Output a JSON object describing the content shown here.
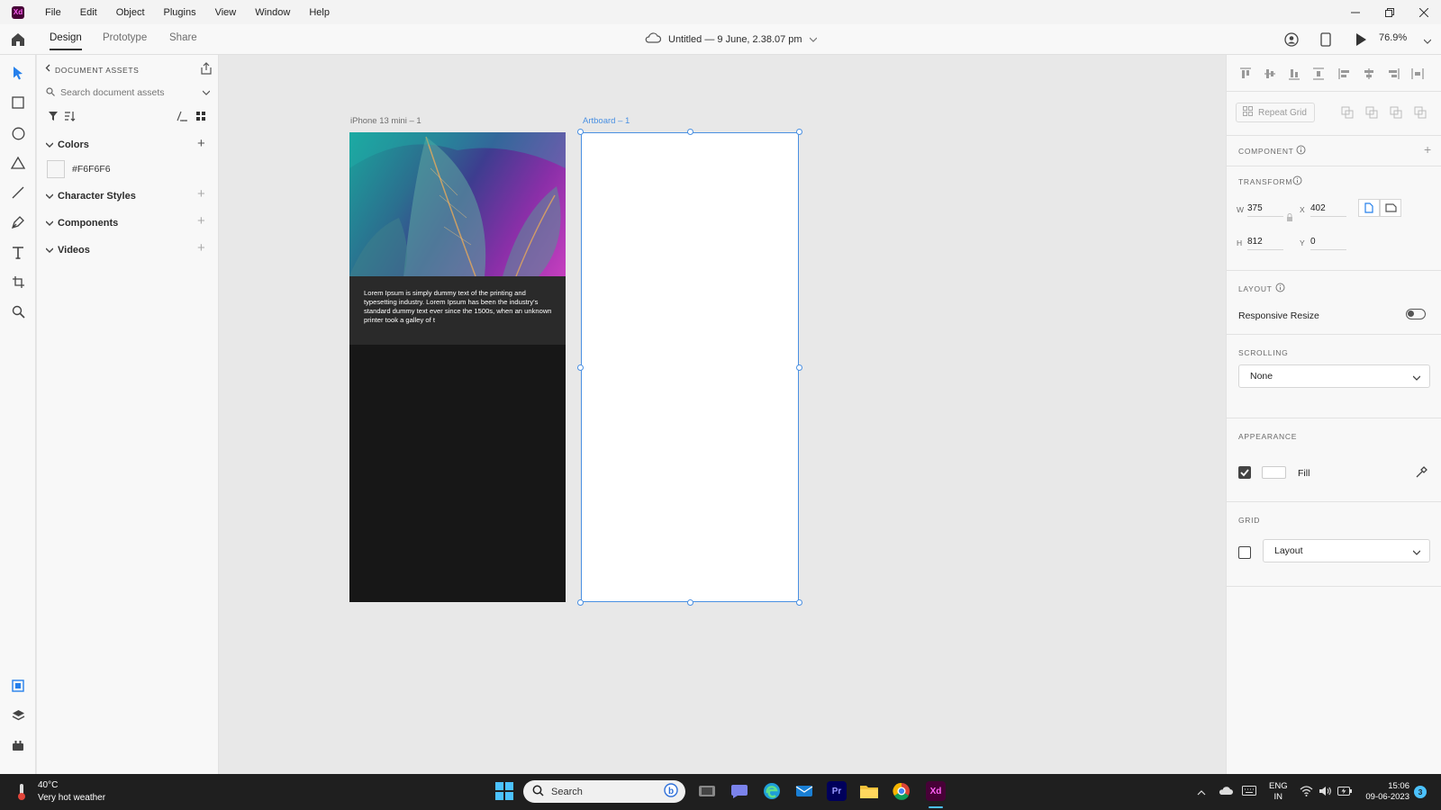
{
  "app": {
    "logo_text": "Xd",
    "menu": [
      "File",
      "Edit",
      "Object",
      "Plugins",
      "View",
      "Window",
      "Help"
    ]
  },
  "toolbar": {
    "tabs": [
      "Design",
      "Prototype",
      "Share"
    ],
    "active_tab": "Design",
    "document_title": "Untitled — 9 June, 2.38.07 pm",
    "zoom": "76.9%"
  },
  "assets": {
    "title": "DOCUMENT ASSETS",
    "search_placeholder": "Search document assets",
    "sections": {
      "colors": "Colors",
      "character_styles": "Character Styles",
      "components": "Components",
      "videos": "Videos"
    },
    "colors": [
      {
        "hex": "#F6F6F6",
        "label": "#F6F6F6"
      }
    ]
  },
  "canvas": {
    "artboards": [
      {
        "label": "iPhone 13 mini – 1",
        "body_text": "Lorem Ipsum is simply dummy text of the printing and typesetting industry. Lorem Ipsum has been the industry's standard dummy text ever since the 1500s, when an unknown printer took a galley of t"
      },
      {
        "label": "Artboard – 1",
        "selected": true
      }
    ]
  },
  "properties": {
    "repeat_grid": "Repeat Grid",
    "component_head": "COMPONENT",
    "transform_head": "TRANSFORM",
    "transform": {
      "w_label": "W",
      "w": "375",
      "h_label": "H",
      "h": "812",
      "x_label": "X",
      "x": "402",
      "y_label": "Y",
      "y": "0"
    },
    "layout_head": "LAYOUT",
    "responsive_resize": "Responsive Resize",
    "responsive_resize_on": false,
    "scrolling_head": "SCROLLING",
    "scrolling_value": "None",
    "appearance_head": "APPEARANCE",
    "fill_label": "Fill",
    "fill_checked": true,
    "fill_color": "#FFFFFF",
    "grid_head": "GRID",
    "grid_value": "Layout",
    "grid_checked": false
  },
  "taskbar": {
    "weather_temp": "40°C",
    "weather_desc": "Very hot weather",
    "search_label": "Search",
    "apps": [
      "windows-start",
      "search",
      "task-view",
      "teams",
      "edge",
      "mail",
      "premiere-pro",
      "file-explorer",
      "chrome",
      "adobe-xd"
    ],
    "premiere_label": "Pr",
    "xd_label": "Xd",
    "lang_1": "ENG",
    "lang_2": "IN",
    "time": "15:06",
    "date": "09-06-2023",
    "notification_count": "3"
  },
  "colors": {
    "accent": "#4A90E2",
    "xd_brand": "#470137",
    "xd_pink": "#FF61F6",
    "artboard_dark": "#171717"
  }
}
